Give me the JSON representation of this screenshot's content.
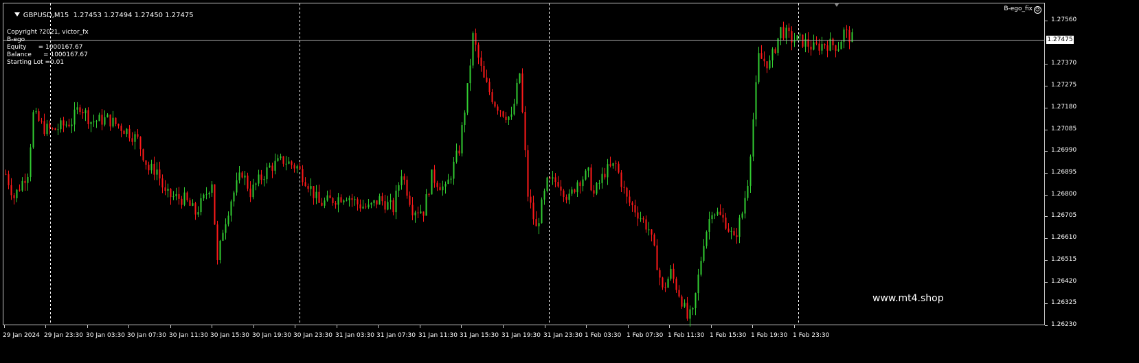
{
  "header": {
    "symbol_timeframe": "GBPUSD,M15",
    "quote": "1.27453 1.27494 1.27450 1.27475"
  },
  "info_panel": {
    "lines": [
      "Copyright ?2021, victor_fx",
      "B-ego",
      "Equity      = 1000167.67",
      "Balance      = 1000167.67",
      "Starting Lot =0.01"
    ]
  },
  "indicator_name": "B-ego_fix",
  "current_price": "1.27475",
  "watermark": "www.mt4.shop",
  "price_scale": [
    "1.27560",
    "1.27370",
    "1.27275",
    "1.27180",
    "1.27085",
    "1.26990",
    "1.26895",
    "1.26800",
    "1.26705",
    "1.26610",
    "1.26515",
    "1.26420",
    "1.26325",
    "1.26230"
  ],
  "time_scale": [
    "29 Jan 2024",
    "29 Jan 23:30",
    "30 Jan 03:30",
    "30 Jan 07:30",
    "30 Jan 11:30",
    "30 Jan 15:30",
    "30 Jan 19:30",
    "30 Jan 23:30",
    "31 Jan 03:30",
    "31 Jan 07:30",
    "31 Jan 11:30",
    "31 Jan 15:30",
    "31 Jan 19:30",
    "31 Jan 23:30",
    "1 Feb 03:30",
    "1 Feb 07:30",
    "1 Feb 11:30",
    "1 Feb 15:30",
    "1 Feb 19:30",
    "1 Feb 23:30"
  ],
  "colors": {
    "bull": "#32cd32",
    "bear": "#ff1a1a",
    "grid": "#c8c8c8",
    "background": "#000000"
  },
  "chart_data": {
    "type": "candlestick",
    "symbol": "GBPUSD",
    "timeframe": "M15",
    "ylim": [
      1.2623,
      1.2756
    ],
    "price_path": [
      [
        0,
        1.2689
      ],
      [
        3,
        1.2679
      ],
      [
        8,
        1.269
      ],
      [
        10,
        1.2715
      ],
      [
        14,
        1.2709
      ],
      [
        17,
        1.2708
      ],
      [
        24,
        1.2712
      ],
      [
        27,
        1.2719
      ],
      [
        31,
        1.2712
      ],
      [
        37,
        1.2713
      ],
      [
        44,
        1.2708
      ],
      [
        48,
        1.2704
      ],
      [
        52,
        1.2691
      ],
      [
        55,
        1.2691
      ],
      [
        58,
        1.268
      ],
      [
        61,
        1.2679
      ],
      [
        65,
        1.2678
      ],
      [
        69,
        1.2672
      ],
      [
        72,
        1.2678
      ],
      [
        75,
        1.2686
      ],
      [
        77,
        1.265
      ],
      [
        79,
        1.2665
      ],
      [
        82,
        1.2678
      ],
      [
        86,
        1.269
      ],
      [
        89,
        1.2681
      ],
      [
        92,
        1.2686
      ],
      [
        96,
        1.2692
      ],
      [
        101,
        1.2695
      ],
      [
        106,
        1.2692
      ],
      [
        110,
        1.2685
      ],
      [
        114,
        1.2676
      ],
      [
        117,
        1.2677
      ],
      [
        124,
        1.268
      ],
      [
        128,
        1.2676
      ],
      [
        132,
        1.2674
      ],
      [
        136,
        1.2678
      ],
      [
        141,
        1.2674
      ],
      [
        144,
        1.269
      ],
      [
        148,
        1.2674
      ],
      [
        152,
        1.2673
      ],
      [
        155,
        1.2688
      ],
      [
        160,
        1.2682
      ],
      [
        165,
        1.27
      ],
      [
        168,
        1.2726
      ],
      [
        170,
        1.2749
      ],
      [
        174,
        1.273
      ],
      [
        178,
        1.272
      ],
      [
        181,
        1.2716
      ],
      [
        184,
        1.2713
      ],
      [
        187,
        1.2733
      ],
      [
        190,
        1.268
      ],
      [
        193,
        1.2665
      ],
      [
        197,
        1.2685
      ],
      [
        201,
        1.2686
      ],
      [
        205,
        1.2678
      ],
      [
        208,
        1.2686
      ],
      [
        212,
        1.2689
      ],
      [
        214,
        1.268
      ],
      [
        218,
        1.269
      ],
      [
        222,
        1.2693
      ],
      [
        226,
        1.2678
      ],
      [
        230,
        1.2672
      ],
      [
        234,
        1.2665
      ],
      [
        237,
        1.265
      ],
      [
        239,
        1.2638
      ],
      [
        242,
        1.2646
      ],
      [
        246,
        1.2634
      ],
      [
        248,
        1.2626
      ],
      [
        250,
        1.2628
      ],
      [
        254,
        1.266
      ],
      [
        257,
        1.2674
      ],
      [
        262,
        1.2668
      ],
      [
        265,
        1.266
      ],
      [
        268,
        1.2672
      ],
      [
        270,
        1.2686
      ],
      [
        274,
        1.274
      ],
      [
        278,
        1.2737
      ],
      [
        282,
        1.2752
      ],
      [
        286,
        1.2748
      ],
      [
        290,
        1.2747
      ],
      [
        294,
        1.2744
      ],
      [
        298,
        1.2746
      ],
      [
        303,
        1.2745
      ],
      [
        305,
        1.2751
      ],
      [
        308,
        1.2748
      ]
    ],
    "candle_count": 309,
    "vertical_separators": [
      "29 Jan 23:30",
      "30 Jan 23:30",
      "31 Jan 23:30",
      "1 Feb 23:30"
    ],
    "current_price_line": 1.27475
  }
}
